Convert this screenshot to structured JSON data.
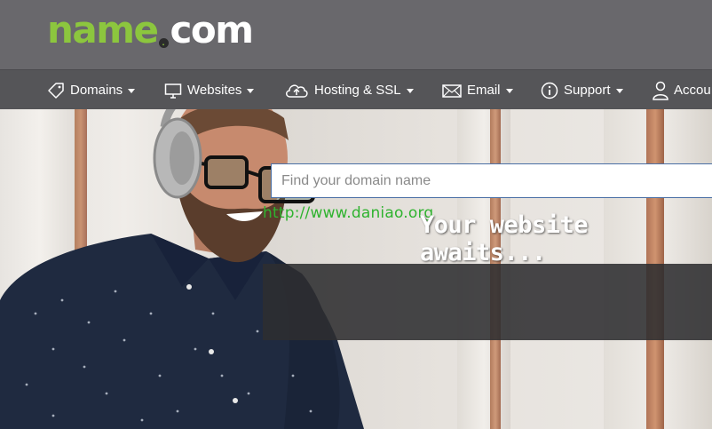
{
  "brand": {
    "logo_name": "name",
    "logo_dot": ".",
    "logo_com": "com",
    "accent_color": "#8cc63e"
  },
  "nav": {
    "items": [
      {
        "label": "Domains",
        "icon": "tag-icon"
      },
      {
        "label": "Websites",
        "icon": "monitor-icon"
      },
      {
        "label": "Hosting & SSL",
        "icon": "cloud-upload-icon"
      },
      {
        "label": "Email",
        "icon": "envelope-icon"
      },
      {
        "label": "Support",
        "icon": "info-icon"
      },
      {
        "label": "Accou",
        "icon": "user-icon"
      }
    ]
  },
  "hero": {
    "watermark": "http://www.daniao.org",
    "headline": "Your website awaits...",
    "search_placeholder": "Find your domain name"
  }
}
